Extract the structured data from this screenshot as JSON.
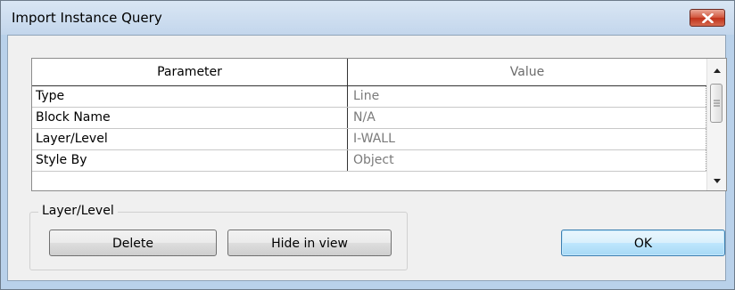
{
  "window": {
    "title": "Import Instance Query",
    "close_icon": "close-icon"
  },
  "grid": {
    "columns": [
      "Parameter",
      "Value"
    ],
    "rows": [
      {
        "parameter": "Type",
        "value": "Line"
      },
      {
        "parameter": "Block Name",
        "value": "N/A"
      },
      {
        "parameter": "Layer/Level",
        "value": "I-WALL"
      },
      {
        "parameter": "Style By",
        "value": "Object"
      }
    ]
  },
  "group": {
    "label": "Layer/Level",
    "delete_label": "Delete",
    "hide_label": "Hide in view"
  },
  "actions": {
    "ok_label": "OK"
  }
}
